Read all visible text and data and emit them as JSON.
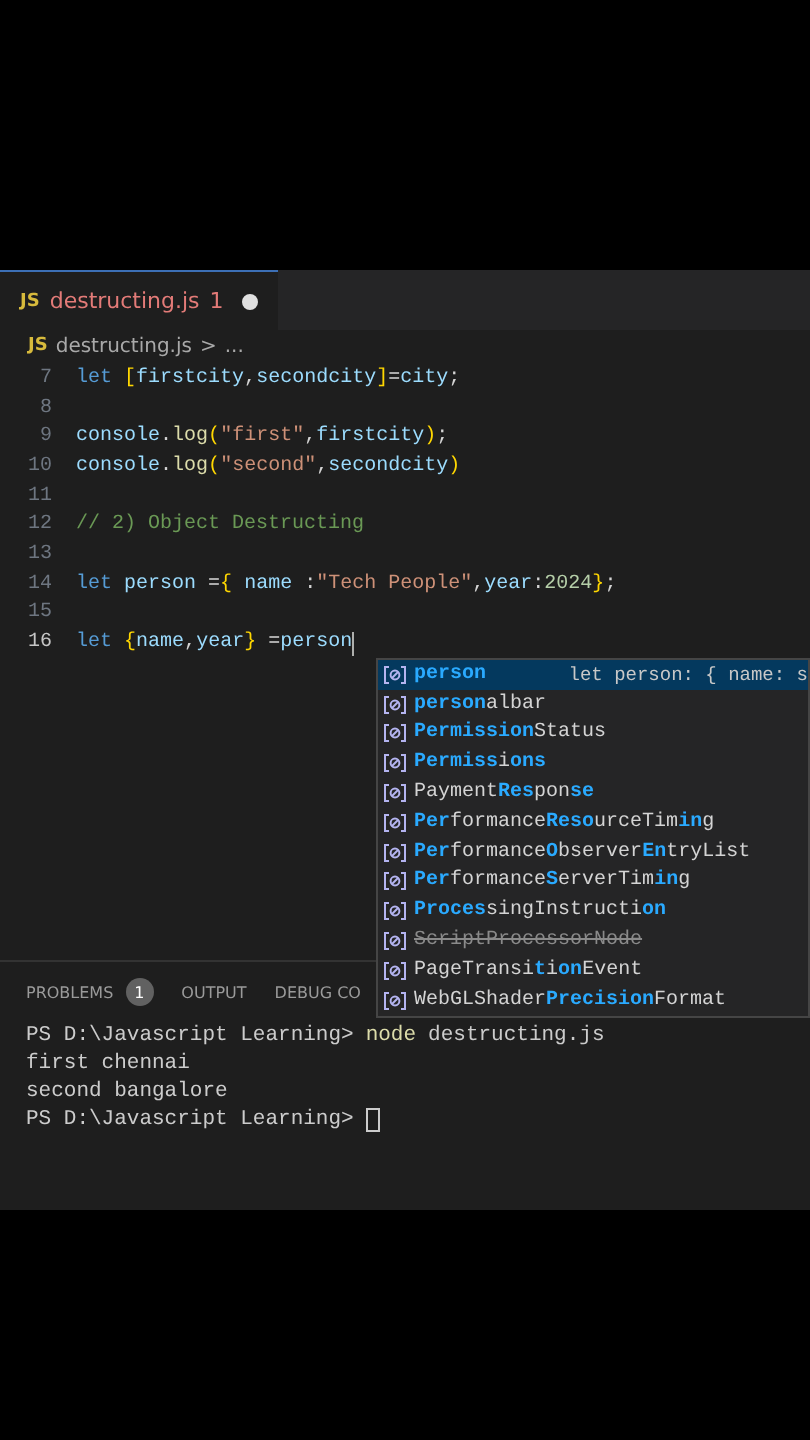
{
  "tab": {
    "icon_text": "JS",
    "label": "destructing.js",
    "problems": "1",
    "modified": true
  },
  "breadcrumb": {
    "icon_text": "JS",
    "file": "destructing.js",
    "separator": ">",
    "rest": "..."
  },
  "code_lines": [
    {
      "number": "7",
      "current": false,
      "tokens": [
        {
          "kind": "keyword",
          "text": "let "
        },
        {
          "kind": "bracket",
          "text": "["
        },
        {
          "kind": "var",
          "text": "firstcity"
        },
        {
          "kind": "plain",
          "text": ","
        },
        {
          "kind": "var",
          "text": "secondcity"
        },
        {
          "kind": "bracket",
          "text": "]"
        },
        {
          "kind": "plain",
          "text": "="
        },
        {
          "kind": "var",
          "text": "city"
        },
        {
          "kind": "plain",
          "text": ";"
        }
      ]
    },
    {
      "number": "8",
      "current": false
    },
    {
      "number": "9",
      "current": false,
      "tokens": [
        {
          "kind": "var",
          "text": "console"
        },
        {
          "kind": "plain",
          "text": "."
        },
        {
          "kind": "fn",
          "text": "log"
        },
        {
          "kind": "bracket",
          "text": "("
        },
        {
          "kind": "string",
          "text": "\"first\""
        },
        {
          "kind": "plain",
          "text": ","
        },
        {
          "kind": "var",
          "text": "firstcity"
        },
        {
          "kind": "bracket",
          "text": ")"
        },
        {
          "kind": "plain",
          "text": ";"
        }
      ]
    },
    {
      "number": "10",
      "current": false,
      "tokens": [
        {
          "kind": "var",
          "text": "console"
        },
        {
          "kind": "plain",
          "text": "."
        },
        {
          "kind": "fn",
          "text": "log"
        },
        {
          "kind": "bracket",
          "text": "("
        },
        {
          "kind": "string",
          "text": "\"second\""
        },
        {
          "kind": "plain",
          "text": ","
        },
        {
          "kind": "var",
          "text": "secondcity"
        },
        {
          "kind": "bracket",
          "text": ")"
        }
      ]
    },
    {
      "number": "11",
      "current": false
    },
    {
      "number": "12",
      "current": false,
      "tokens": [
        {
          "kind": "comment",
          "text": "// 2) Object Destructing"
        }
      ]
    },
    {
      "number": "13",
      "current": false
    },
    {
      "number": "14",
      "current": false,
      "tokens": [
        {
          "kind": "keyword",
          "text": "let "
        },
        {
          "kind": "var",
          "text": "person"
        },
        {
          "kind": "plain",
          "text": " ="
        },
        {
          "kind": "bracket",
          "text": "{"
        },
        {
          "kind": "var",
          "text": " name"
        },
        {
          "kind": "plain",
          "text": " :"
        },
        {
          "kind": "string",
          "text": "\"Tech People\""
        },
        {
          "kind": "plain",
          "text": ","
        },
        {
          "kind": "var",
          "text": "year"
        },
        {
          "kind": "plain",
          "text": ":"
        },
        {
          "kind": "number",
          "text": "2024"
        },
        {
          "kind": "bracket",
          "text": "}"
        },
        {
          "kind": "plain",
          "text": ";"
        }
      ]
    },
    {
      "number": "15",
      "current": false
    },
    {
      "number": "16",
      "current": true,
      "tokens": [
        {
          "kind": "keyword",
          "text": "let "
        },
        {
          "kind": "bracket",
          "text": "{"
        },
        {
          "kind": "var",
          "text": "name"
        },
        {
          "kind": "plain",
          "text": ","
        },
        {
          "kind": "var",
          "text": "year"
        },
        {
          "kind": "bracket",
          "text": "}"
        },
        {
          "kind": "plain",
          "text": " ="
        },
        {
          "kind": "var",
          "text": "person"
        }
      ]
    }
  ],
  "suggestions": [
    {
      "label": "**person**",
      "selected": true,
      "detail": "let person: { name: s"
    },
    {
      "label": "**person**albar",
      "selected": false
    },
    {
      "label": "**Permission**Status",
      "selected": false
    },
    {
      "label": "**Permiss**i**ons**",
      "selected": false
    },
    {
      "label": "Payment**Res**pon**se**",
      "selected": false
    },
    {
      "label": "**Per**formance**Reso**urceTim**in**g",
      "selected": false
    },
    {
      "label": "**Per**formance**O**bserver**En**tryList",
      "selected": false
    },
    {
      "label": "**Per**formance**S**erverTim**in**g",
      "selected": false
    },
    {
      "label": "**Proces**singInstructi**on**",
      "selected": false
    },
    {
      "label": "ScriptProcessorNode",
      "selected": false,
      "deprecated": true
    },
    {
      "label": "PageTransi**t**i**on**Event",
      "selected": false
    },
    {
      "label": "WebGLShader**Precision**Format",
      "selected": false
    }
  ],
  "panel_tabs": [
    {
      "label": "PROBLEMS",
      "badge": "1"
    },
    {
      "label": "OUTPUT"
    },
    {
      "label": "DEBUG CO"
    }
  ],
  "terminal": [
    {
      "kind": "prompt",
      "prompt": "PS D:\\Javascript Learning>",
      "command": "node",
      "args": "destructing.js"
    },
    {
      "kind": "output",
      "text": "first chennai"
    },
    {
      "kind": "output",
      "text": "second bangalore"
    },
    {
      "kind": "cursor",
      "prompt": "PS D:\\Javascript Learning>"
    }
  ]
}
